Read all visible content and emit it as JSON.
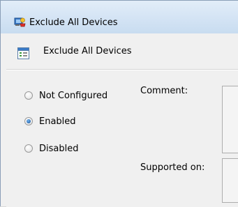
{
  "window": {
    "title": "Exclude All Devices"
  },
  "header": {
    "policy_name": "Exclude All Devices"
  },
  "options": [
    {
      "label": "Not Configured",
      "checked": false
    },
    {
      "label": "Enabled",
      "checked": true
    },
    {
      "label": "Disabled",
      "checked": false
    }
  ],
  "fields": {
    "comment_label": "Comment:",
    "supported_label": "Supported on:"
  }
}
